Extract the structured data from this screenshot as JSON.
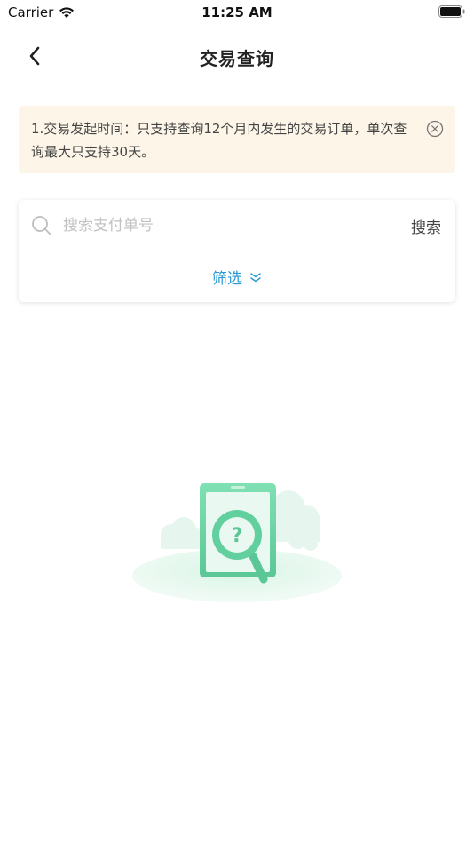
{
  "status_bar": {
    "carrier": "Carrier",
    "time": "11:25 AM"
  },
  "nav": {
    "title": "交易查询",
    "back_icon": "chevron-left-icon"
  },
  "notice": {
    "text": "1.交易发起时间：只支持查询12个月内发生的交易订单，单次查询最大只支持30天。",
    "close_icon": "close-circle-icon",
    "background": "#fdf6e8"
  },
  "search": {
    "placeholder": "搜索支付单号",
    "value": "",
    "button_label": "搜索",
    "icon": "search-icon"
  },
  "filter": {
    "label": "筛选",
    "icon": "double-chevron-down-icon",
    "color": "#2a9ad4"
  },
  "empty_state": {
    "icon": "search-document-illustration",
    "accent": "#6fd8a8"
  }
}
